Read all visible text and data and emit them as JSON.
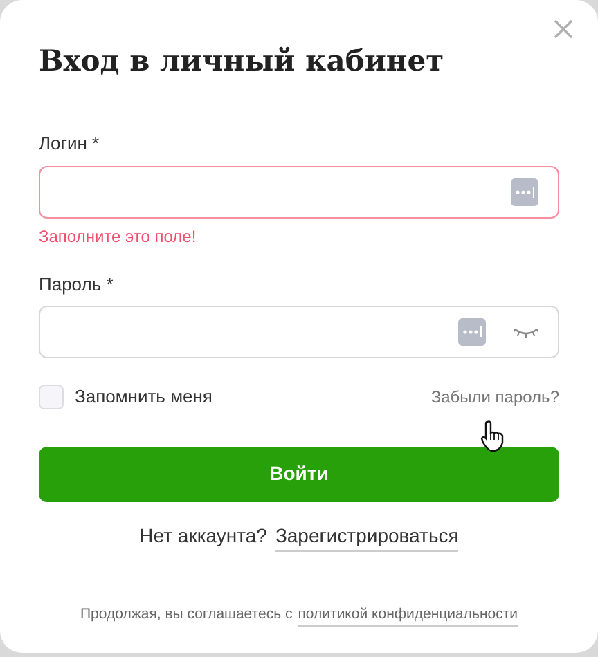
{
  "dialog": {
    "title": "Вход в личный кабинет"
  },
  "fields": [
    {
      "label": "Логин *",
      "invalid": true,
      "error": "Заполните это поле!",
      "kind": "text"
    },
    {
      "label": "Пароль *",
      "invalid": false,
      "kind": "password"
    }
  ],
  "remember": {
    "label": "Запомнить меня",
    "checked": false
  },
  "forgot_link": "Забыли пароль?",
  "submit_button": "Войти",
  "register": {
    "prompt": "Нет аккаунта?",
    "link": "Зарегистрироваться"
  },
  "footer": {
    "text": "Продолжая, вы соглашаетесь с",
    "link": "политикой конфиденциальности"
  }
}
